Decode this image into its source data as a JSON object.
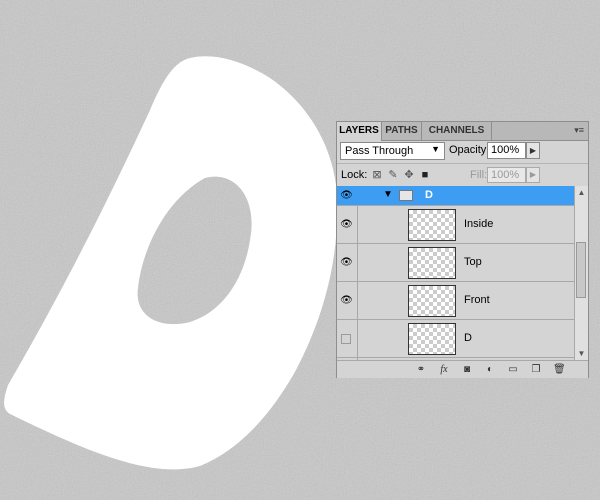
{
  "canvas": {
    "background_color": "#c8c8c8",
    "shape_color": "#ffffff"
  },
  "panel": {
    "tabs": [
      {
        "label": "LAYERS",
        "active": true
      },
      {
        "label": "PATHS",
        "active": false
      },
      {
        "label": "CHANNELS",
        "active": false
      }
    ],
    "menu_icon": "panel-menu-icon",
    "blend_mode": "Pass Through",
    "opacity_label": "Opacity:",
    "opacity_value": "100%",
    "lock_label": "Lock:",
    "lock_icons": [
      "lock-transparent-icon",
      "lock-image-icon",
      "lock-position-icon",
      "lock-all-icon"
    ],
    "fill_label": "Fill:",
    "fill_value": "100%",
    "group": {
      "name": "D",
      "visible": true,
      "selected": true,
      "selection_color": "#3d9df3"
    },
    "layers": [
      {
        "name": "Inside",
        "visible": true
      },
      {
        "name": "Top",
        "visible": true
      },
      {
        "name": "Front",
        "visible": true
      },
      {
        "name": "D",
        "visible": false
      }
    ],
    "bottom_icons": [
      "link-layers-icon",
      "fx-icon",
      "add-mask-icon",
      "adjustment-layer-icon",
      "new-group-icon",
      "new-layer-icon",
      "trash-icon"
    ]
  }
}
